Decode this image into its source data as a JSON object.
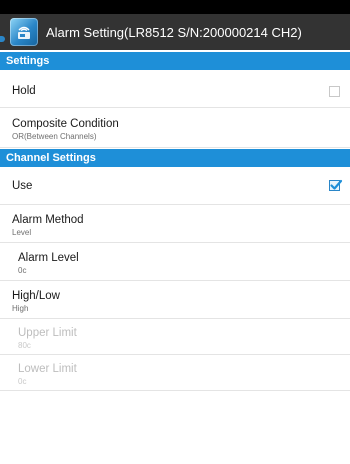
{
  "window": {
    "title": "Alarm Setting(LR8512 S/N:200000214 CH2)",
    "icon": "wireless-logger-icon"
  },
  "sections": {
    "settings": {
      "header": "Settings"
    },
    "channel_settings": {
      "header": "Channel Settings"
    }
  },
  "items": {
    "hold": {
      "title": "Hold",
      "checked": false
    },
    "composite_condition": {
      "title": "Composite Condition",
      "summary": "OR(Between Channels)"
    },
    "use": {
      "title": "Use",
      "checked": true
    },
    "alarm_method": {
      "title": "Alarm Method",
      "summary": "Level"
    },
    "alarm_level": {
      "title": "Alarm Level",
      "summary": "0c"
    },
    "high_low": {
      "title": "High/Low",
      "summary": "High"
    },
    "upper_limit": {
      "title": "Upper Limit",
      "summary": "80c",
      "enabled": false
    },
    "lower_limit": {
      "title": "Lower Limit",
      "summary": "0c",
      "enabled": false
    }
  },
  "colors": {
    "accent": "#1e8fd8",
    "action_bar": "#333333",
    "status_bar": "#000000"
  }
}
